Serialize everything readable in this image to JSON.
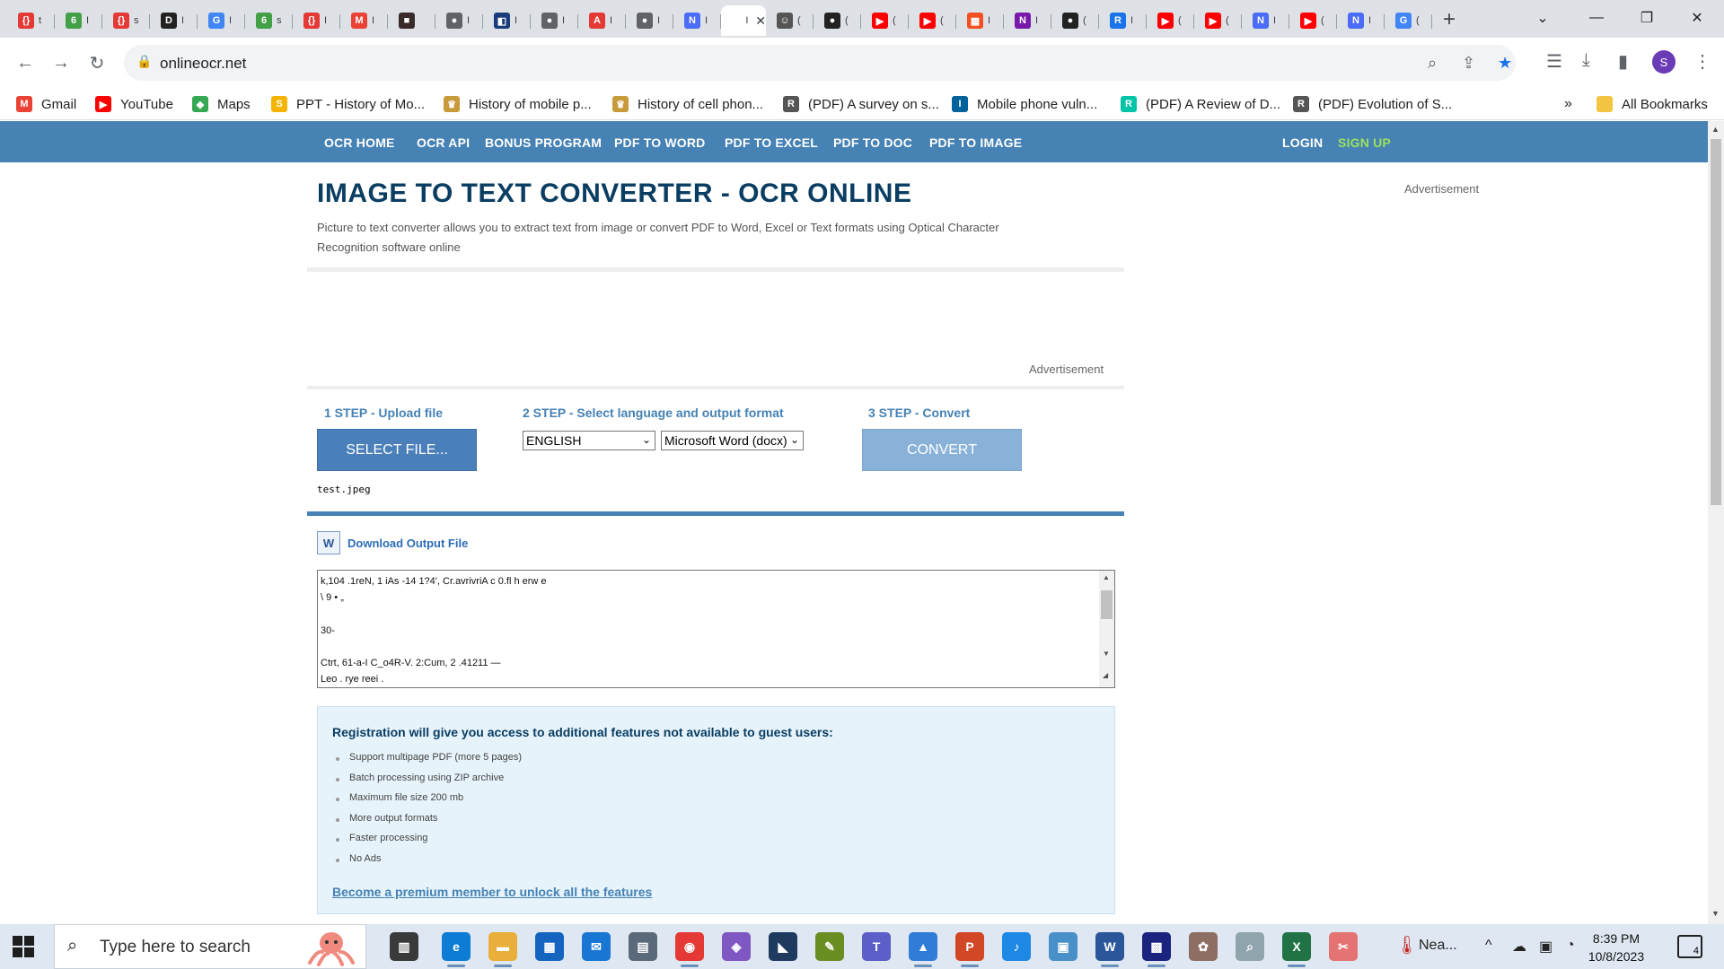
{
  "browser": {
    "url": "onlineocr.net",
    "tabs": [
      {
        "icon": "{}",
        "color": "#e53935",
        "label": "t"
      },
      {
        "icon": "6",
        "color": "#43a047",
        "label": "I"
      },
      {
        "icon": "{}",
        "color": "#e53935",
        "label": "s"
      },
      {
        "icon": "D",
        "color": "#222222",
        "label": "I"
      },
      {
        "icon": "G",
        "color": "#4285f4",
        "label": "I"
      },
      {
        "icon": "6",
        "color": "#43a047",
        "label": "s"
      },
      {
        "icon": "{}",
        "color": "#e53935",
        "label": "I"
      },
      {
        "icon": "M",
        "color": "#ea4335",
        "label": "I"
      },
      {
        "icon": "■",
        "color": "#3a2a2a",
        "label": ""
      },
      {
        "icon": "●",
        "color": "#5f6368",
        "label": "I"
      },
      {
        "icon": "◧",
        "color": "#1a3c7a",
        "label": "I"
      },
      {
        "icon": "●",
        "color": "#5f6368",
        "label": "I"
      },
      {
        "icon": "A",
        "color": "#e53935",
        "label": "I"
      },
      {
        "icon": "●",
        "color": "#5f6368",
        "label": "I"
      },
      {
        "icon": "N",
        "color": "#4a6cf7",
        "label": "I"
      },
      {
        "icon": "",
        "color": "#ffffff",
        "label": "I",
        "active": true
      },
      {
        "icon": "☺",
        "color": "#555555",
        "label": "("
      },
      {
        "icon": "●",
        "color": "#222222",
        "label": "("
      },
      {
        "icon": "▶",
        "color": "#ff0000",
        "label": "("
      },
      {
        "icon": "▶",
        "color": "#ff0000",
        "label": "("
      },
      {
        "icon": "▦",
        "color": "#f25022",
        "label": "I"
      },
      {
        "icon": "N",
        "color": "#7719aa",
        "label": "I"
      },
      {
        "icon": "●",
        "color": "#222222",
        "label": "("
      },
      {
        "icon": "R",
        "color": "#1a73e8",
        "label": "I"
      },
      {
        "icon": "▶",
        "color": "#ff0000",
        "label": "("
      },
      {
        "icon": "▶",
        "color": "#ff0000",
        "label": "("
      },
      {
        "icon": "N",
        "color": "#4a6cf7",
        "label": "I"
      },
      {
        "icon": "▶",
        "color": "#ff0000",
        "label": "("
      },
      {
        "icon": "N",
        "color": "#4a6cf7",
        "label": "I"
      },
      {
        "icon": "G",
        "color": "#4285f4",
        "label": "("
      }
    ],
    "profile_initial": "S"
  },
  "bookmarks": [
    {
      "label": "Gmail",
      "icon": "M",
      "color": "#ea4335"
    },
    {
      "label": "YouTube",
      "icon": "▶",
      "color": "#ff0000"
    },
    {
      "label": "Maps",
      "icon": "◆",
      "color": "#34a853"
    },
    {
      "label": "PPT - History of Mo...",
      "icon": "S",
      "color": "#f4b400"
    },
    {
      "label": "History of mobile p...",
      "icon": "♛",
      "color": "#c79a3a"
    },
    {
      "label": "History of cell phon...",
      "icon": "♛",
      "color": "#c79a3a"
    },
    {
      "label": "(PDF) A survey on s...",
      "icon": "R",
      "color": "#555555"
    },
    {
      "label": "Mobile phone vuln...",
      "icon": "I",
      "color": "#00629b"
    },
    {
      "label": "(PDF) A Review of D...",
      "icon": "R",
      "color": "#00c4a7"
    },
    {
      "label": "(PDF) Evolution of S...",
      "icon": "R",
      "color": "#555555"
    }
  ],
  "bookmarks_overflow": "»",
  "all_bookmarks": "All Bookmarks",
  "site": {
    "nav": {
      "home": "OCR HOME",
      "api": "OCR API",
      "bonus": "BONUS PROGRAM",
      "pdf_word": "PDF TO WORD",
      "pdf_excel": "PDF TO EXCEL",
      "pdf_doc": "PDF TO DOC",
      "pdf_image": "PDF TO IMAGE",
      "login": "LOGIN",
      "signup": "SIGN UP"
    },
    "title": "IMAGE TO TEXT CONVERTER - OCR ONLINE",
    "subtitle": "Picture to text converter allows you to extract text from image or convert PDF to Word, Excel or Text formats using Optical Character Recognition software online",
    "ad_label": "Advertisement",
    "step1": "1 STEP - Upload file",
    "step2": "2 STEP - Select language and output format",
    "step3": "3 STEP - Convert",
    "select_file_label": "SELECT FILE...",
    "language": "ENGLISH",
    "output_format": "Microsoft Word (docx)",
    "convert_label": "CONVERT",
    "filename": "test.jpeg",
    "download_label": "Download Output File",
    "output_lines": [
      "k,104 .1reN, 1 iAs -14 1?4', Cr.avrivriA c 0.fl h erw e",
      "\\ 9 • „",
      "",
      "30-",
      "",
      "Ctrt, 61-a-I C_o4R-V. 2:Cum, 2 .41211 —",
      "Leo . rye reei ."
    ],
    "registration": {
      "heading": "Registration will give you access to additional features not available to guest users:",
      "features": [
        "Support multipage PDF (more 5 pages)",
        "Batch processing using ZIP archive",
        "Maximum file size 200 mb",
        "More output formats",
        "Faster processing",
        "No Ads"
      ],
      "premium_link": "Become a premium member to unlock all the features"
    }
  },
  "taskbar": {
    "search_placeholder": "Type here to search",
    "weather": "Nea...",
    "time": "8:39 PM",
    "date": "10/8/2023",
    "notification_count": "4"
  }
}
